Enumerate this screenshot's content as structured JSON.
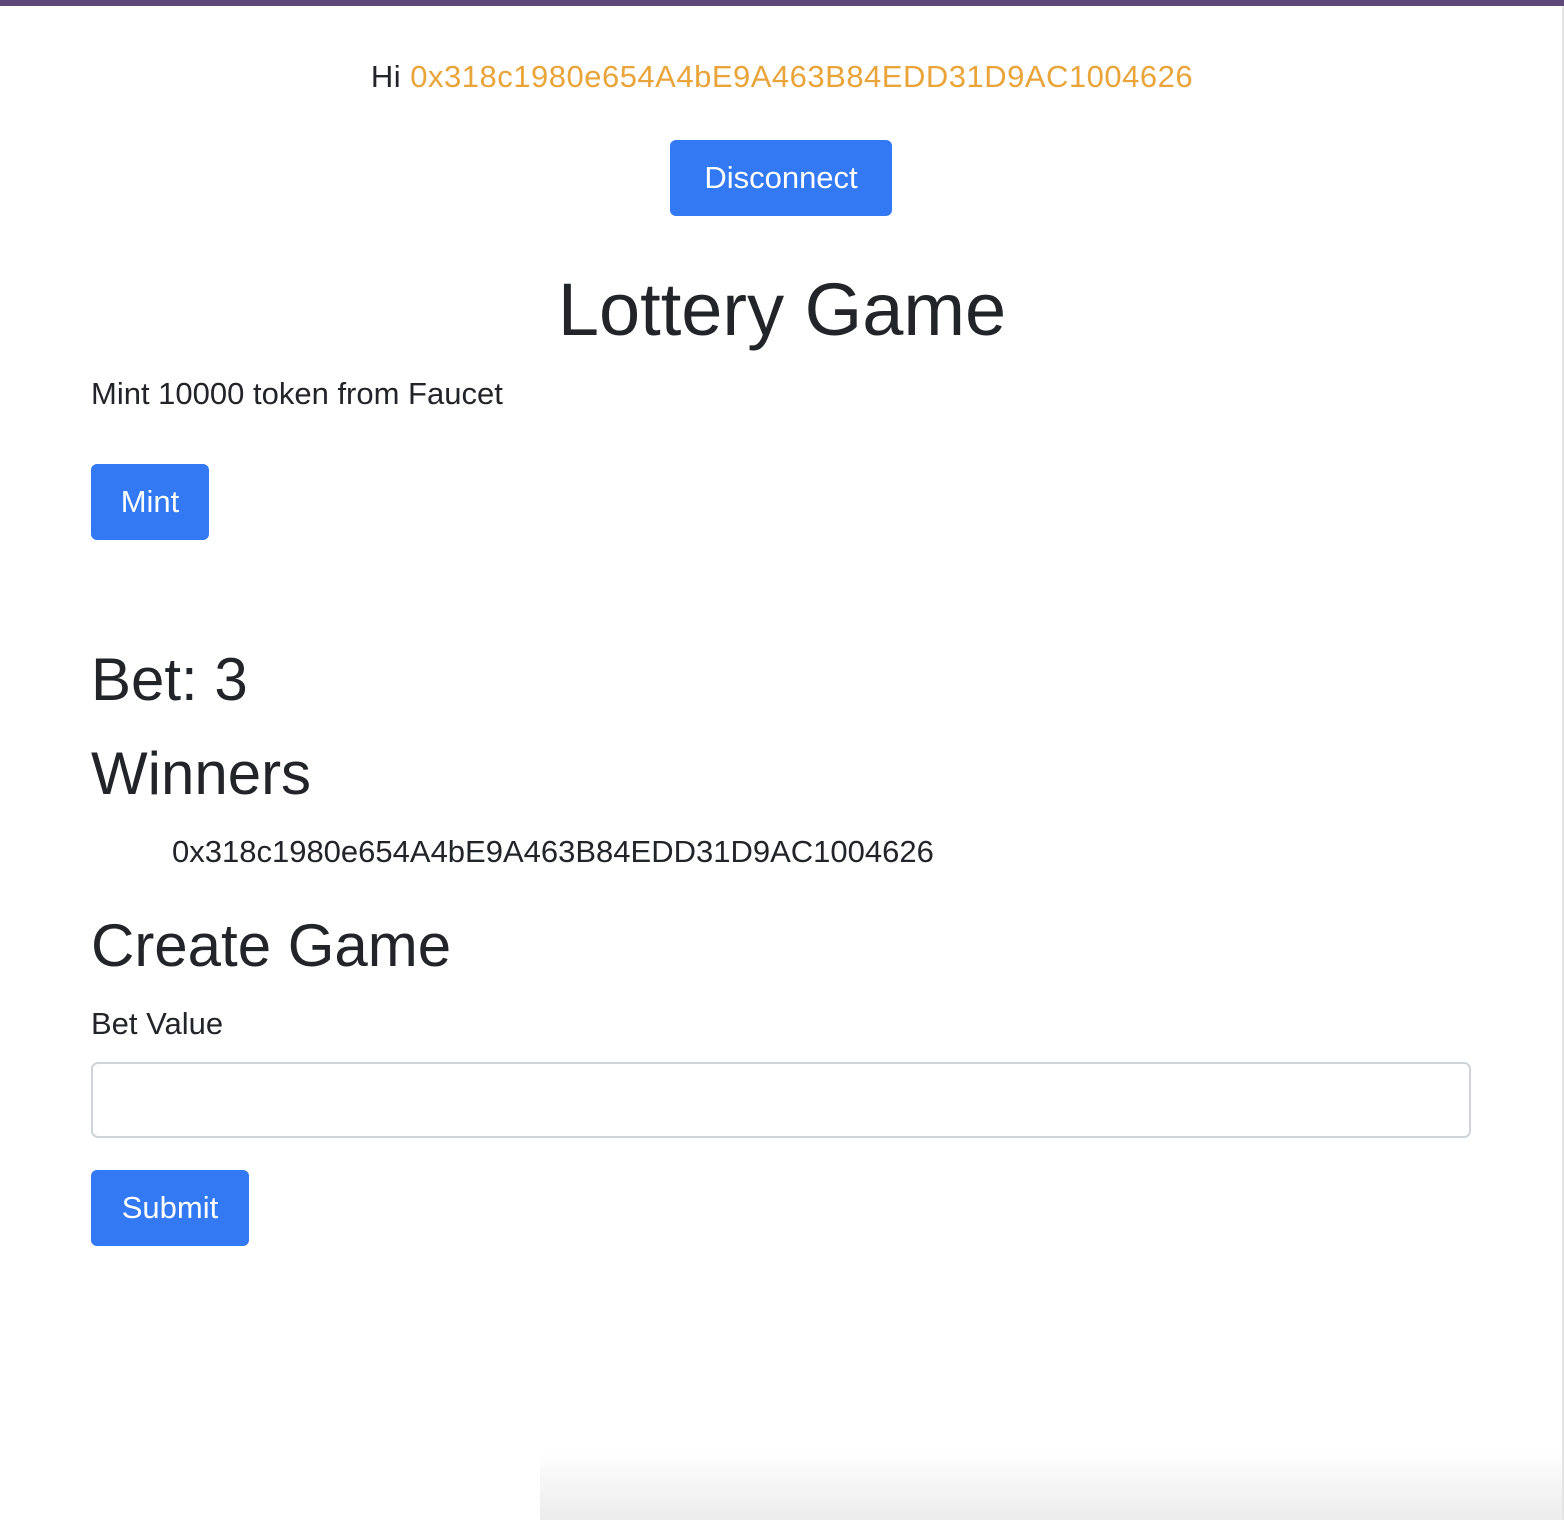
{
  "header": {
    "greeting_prefix": "Hi",
    "account_address": "0x318c1980e654A4bE9A463B84EDD31D9AC1004626",
    "disconnect_label": "Disconnect"
  },
  "main": {
    "title": "Lottery Game",
    "mint_description": "Mint 10000 token from Faucet",
    "mint_label": "Mint",
    "bet_text": "Bet: 3",
    "winners_heading": "Winners",
    "winners": [
      "0x318c1980e654A4bE9A463B84EDD31D9AC1004626"
    ],
    "create_game": {
      "heading": "Create Game",
      "bet_value_label": "Bet Value",
      "bet_value": "",
      "bet_value_placeholder": "",
      "submit_label": "Submit"
    }
  },
  "colors": {
    "primary_button": "#3279f3",
    "address_highlight": "#e9a43a",
    "text": "#212529",
    "window_top_bar": "#5d4a7a"
  }
}
